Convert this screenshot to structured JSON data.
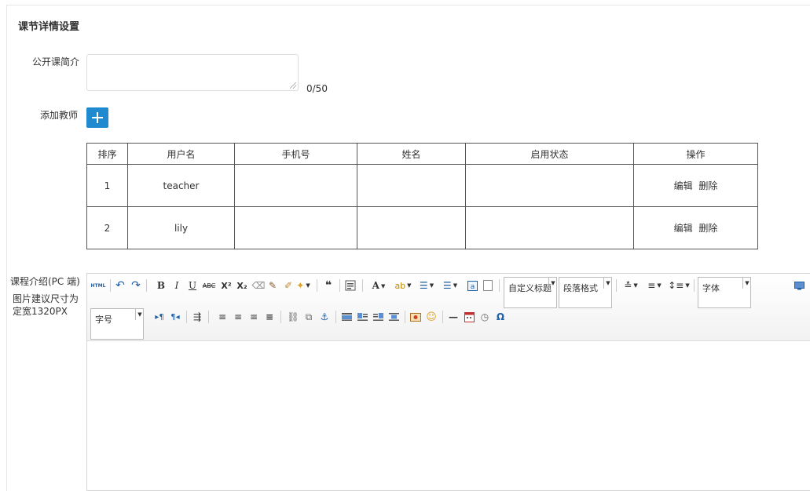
{
  "section_title": "课节详情设置",
  "intro": {
    "label": "公开课简介",
    "value": "",
    "counter": "0/50"
  },
  "teacher": {
    "label": "添加教师",
    "add_icon": "plus-icon",
    "columns": [
      "排序",
      "用户名",
      "手机号",
      "姓名",
      "启用状态",
      "操作"
    ],
    "rows": [
      {
        "order": "1",
        "username": "teacher",
        "phone": "",
        "name": "",
        "status": "",
        "edit": "编辑",
        "delete": "删除"
      },
      {
        "order": "2",
        "username": "lily",
        "phone": "",
        "name": "",
        "status": "",
        "edit": "编辑",
        "delete": "删除"
      }
    ]
  },
  "course_intro": {
    "label": "课程介绍(PC 端)",
    "hint_line1": "图片建议尺寸为",
    "hint_line2": "定宽1320PX"
  },
  "editor": {
    "html_label": "HTML",
    "custom_title": "自定义标题",
    "paragraph_format": "段落格式",
    "font_family": "字体",
    "font_size": "字号",
    "accent_color": "#1f8ad0"
  }
}
